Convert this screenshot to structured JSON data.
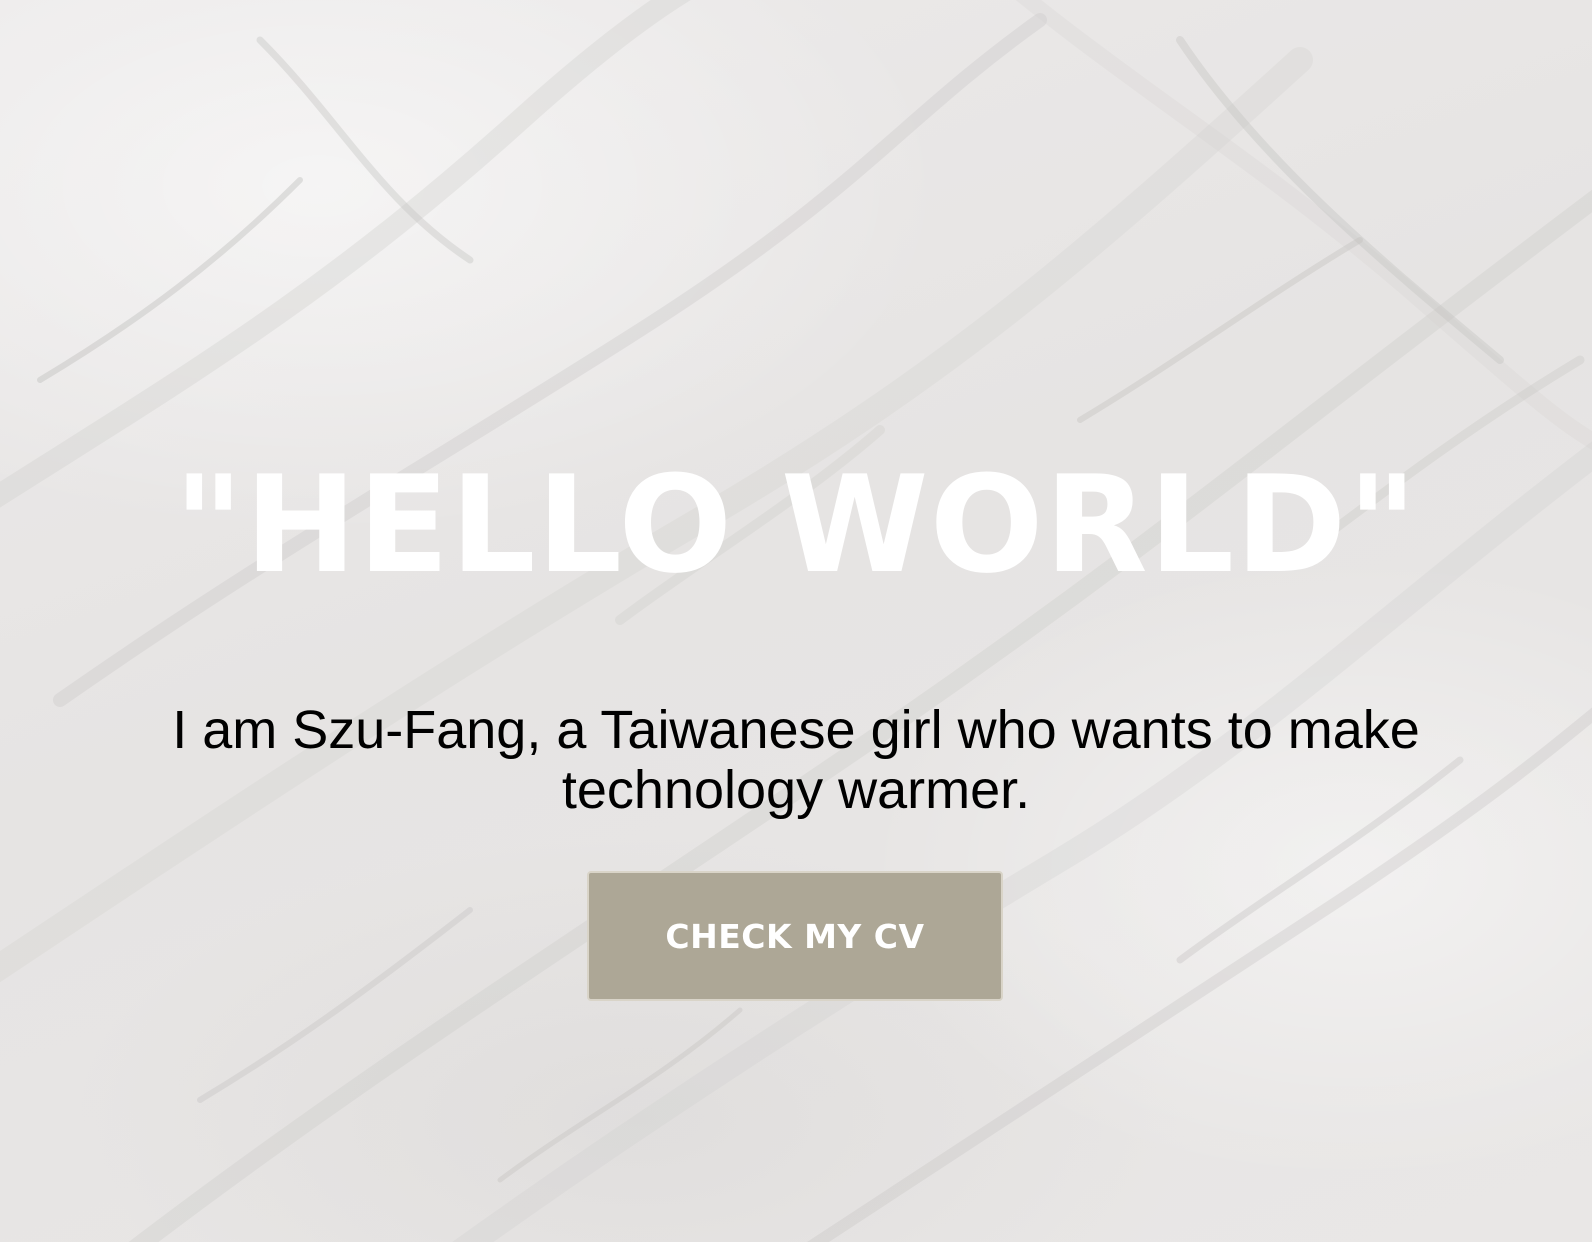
{
  "hero": {
    "title": "\"HELLO WORLD\"",
    "tagline": "I am Szu-Fang, a Taiwanese girl who wants to make technology warmer.",
    "cta_label": "CHECK MY CV"
  },
  "colors": {
    "background": "#e8e6e5",
    "title_text": "#ffffff",
    "tagline_text": "#000000",
    "button_background": "#ada796",
    "button_text": "#ffffff"
  },
  "icons": {
    "background": "marble-texture"
  }
}
